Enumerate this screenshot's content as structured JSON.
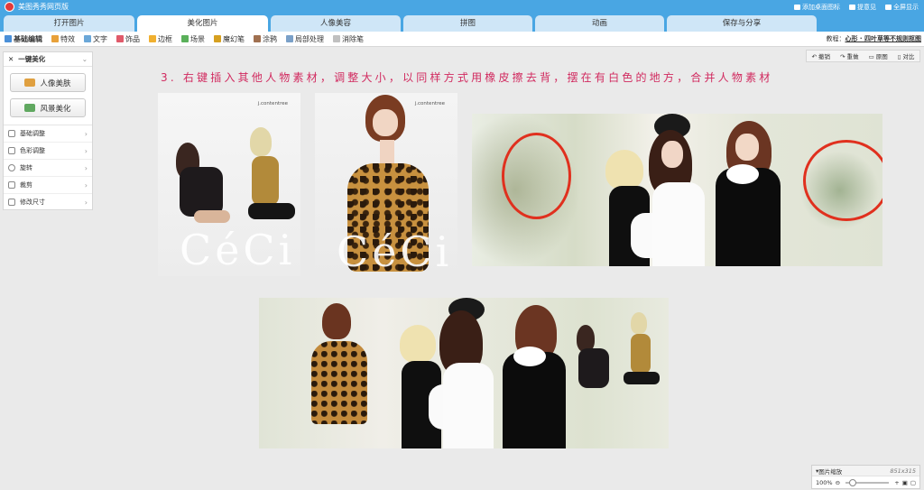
{
  "app": {
    "title": "美图秀秀网页版"
  },
  "title_links": [
    {
      "label": "添加桌面图标",
      "icon": "star-icon"
    },
    {
      "label": "提意见",
      "icon": "comment-icon"
    },
    {
      "label": "全屏显示",
      "icon": "fullscreen-icon"
    }
  ],
  "tabs": [
    "打开图片",
    "美化图片",
    "人像美容",
    "拼图",
    "动画",
    "保存与分享"
  ],
  "active_tab": 1,
  "toolbar": {
    "items": [
      "基础编辑",
      "特效",
      "文字",
      "饰品",
      "边框",
      "场景",
      "魔幻笔",
      "涂鸦",
      "局部处理",
      "消除笔"
    ],
    "tutorial_label": "教程：",
    "tutorial_link": "心形 · 四叶草等不规则抠图"
  },
  "left_panel": {
    "header": "一键美化",
    "buttons": [
      "人像美肤",
      "风景美化"
    ],
    "items": [
      "基础调整",
      "色彩调整",
      "旋转",
      "裁剪",
      "修改尺寸"
    ]
  },
  "right_tools": [
    "撤销",
    "重做",
    "原图",
    "对比"
  ],
  "canvas": {
    "caption": "3. 右键插入其他人物素材，调整大小，以同样方式用橡皮擦去背，摆在有白色的地方，合并人物素材",
    "brand_text": "j.contentree",
    "watermark_text": "CéCi"
  },
  "zoom_panel": {
    "title": "图片缩放",
    "dimensions": "851x315",
    "zoom": "100%",
    "plus": "+"
  },
  "colors": {
    "titlebar": "#49a6e3",
    "caption": "#d12a5f",
    "highlight_circle": "#e0301e"
  }
}
